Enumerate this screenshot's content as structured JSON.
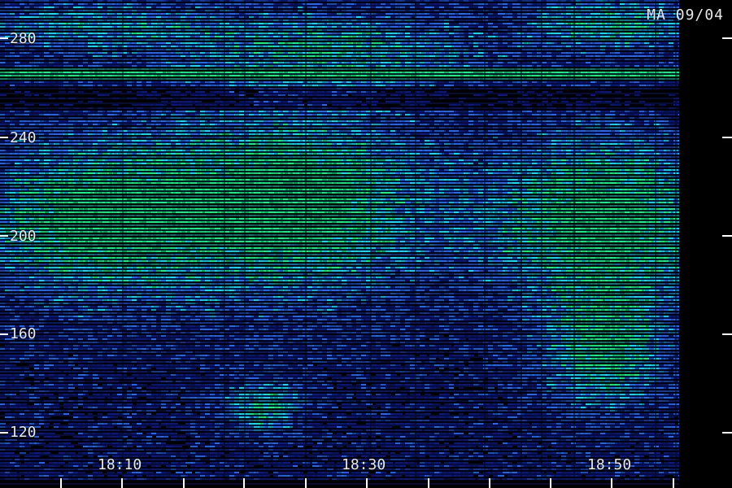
{
  "title_label": "MA 09/04",
  "y_axis": {
    "ticks": [
      "280",
      "240",
      "200",
      "160",
      "120"
    ]
  },
  "x_axis": {
    "ticks": [
      "18:10",
      "18:30",
      "18:50"
    ]
  },
  "colors": {
    "background": "#000000",
    "weak": "#0a1a8c",
    "medium": "#1e6cff",
    "strong": "#00e5ff",
    "peak": "#00ff7a",
    "axis": "#ffffff"
  }
}
